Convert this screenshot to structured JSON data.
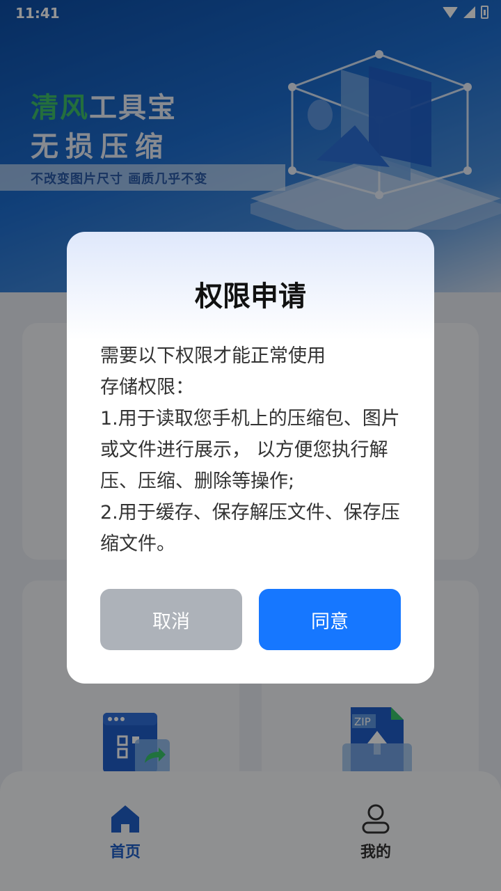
{
  "status_bar": {
    "time": "11:41"
  },
  "banner": {
    "brand_green": "清风",
    "brand_white": "工具宝",
    "slogan": "无损压缩",
    "tagline": "不改变图片尺寸 画质几乎不变"
  },
  "tabbar": {
    "home_label": "首页",
    "me_label": "我的"
  },
  "dialog": {
    "title": "权限申请",
    "lines": [
      "需要以下权限才能正常使用",
      "存储权限：",
      "1.用于读取您手机上的压缩包、图片或文件进行展示， 以方便您执行解压、压缩、删除等操作;",
      "2.用于缓存、保存解压文件、保存压缩文件。"
    ],
    "cancel_label": "取消",
    "agree_label": "同意"
  },
  "colors": {
    "accent": "#1677ff",
    "cancel": "#adb2b9",
    "brand_green": "#3fbf6a",
    "tab_active": "#1f5fc8"
  },
  "icons": [
    "wifi-icon",
    "signal-icon",
    "battery-icon",
    "home-icon",
    "user-icon",
    "qr-share-icon",
    "zip-upload-icon"
  ]
}
